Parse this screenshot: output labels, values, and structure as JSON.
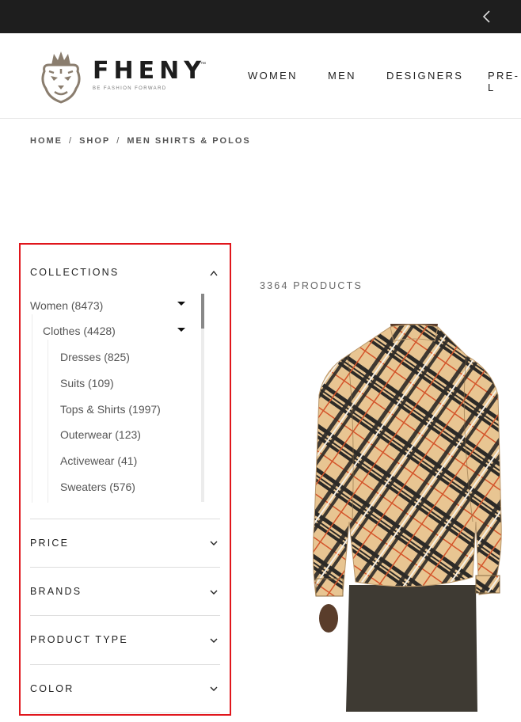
{
  "header": {
    "brand": "FHENY",
    "brand_tm": "™",
    "tagline": "BE FASHION FORWARD",
    "nav": [
      "WOMEN",
      "MEN",
      "DESIGNERS",
      "PRE-L"
    ]
  },
  "breadcrumb": [
    "HOME",
    "SHOP",
    "MEN SHIRTS & POLOS"
  ],
  "breadcrumb_sep": "/",
  "filters": {
    "collections": {
      "title": "COLLECTIONS",
      "items": [
        "Women (8473)",
        "Clothes (4428)",
        "Dresses (825)",
        "Suits (109)",
        "Tops & Shirts (1997)",
        "Outerwear (123)",
        "Activewear (41)",
        "Sweaters (576)"
      ]
    },
    "sections": [
      "PRICE",
      "BRANDS",
      "PRODUCT TYPE",
      "COLOR"
    ]
  },
  "listing": {
    "count_label": "3364 PRODUCTS"
  },
  "colors": {
    "highlight": "#e0161c",
    "topbar": "#1e1e1e",
    "shirt_base": "#e8c592"
  },
  "icons": [
    "chevron-left-icon",
    "tiger-crown-logo",
    "chevron-up-icon",
    "chevron-down-icon",
    "caret-down-icon"
  ]
}
